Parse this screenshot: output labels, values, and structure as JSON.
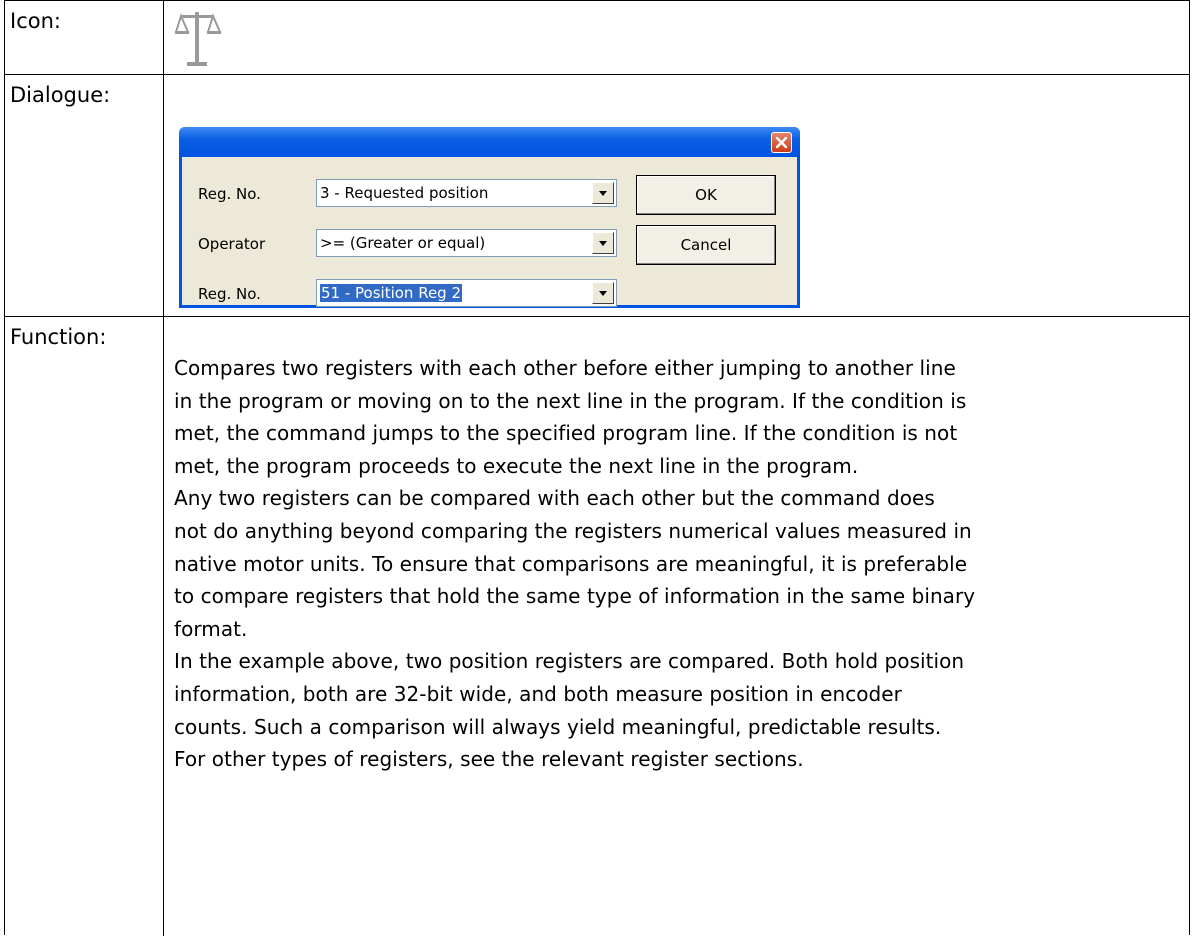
{
  "labels": {
    "icon": "Icon:",
    "dialogue": "Dialogue:",
    "function": "Function:"
  },
  "icon": {
    "name": "scales-icon"
  },
  "dialog": {
    "row1": {
      "label": "Reg. No.",
      "value": "3 - Requested position"
    },
    "row2": {
      "label": "Operator",
      "value": ">= (Greater or equal)"
    },
    "row3": {
      "label": "Reg. No.",
      "value": "51 - Position Reg 2"
    },
    "ok_label": "OK",
    "cancel_label": "Cancel",
    "colors": {
      "title": "#0054e3",
      "body": "#ece9d8",
      "selection": "#316ac5"
    }
  },
  "function_text": {
    "lines": [
      "Compares two registers with each other before either jumping to another line",
      "in the program or moving on to the next line in the program. If the condition is",
      "met, the command jumps to the specified program line. If the condition is not",
      "met, the program proceeds to execute the next line in the program.",
      "Any two registers can be compared with each other but the command does",
      "not do anything beyond comparing the registers numerical values measured in",
      "native motor units. To ensure that comparisons are meaningful, it is preferable",
      "to compare registers that hold the same type of information in the same binary",
      "format.",
      "In the example above, two position registers are compared. Both hold position",
      "information, both are 32-bit wide, and both measure position in encoder",
      "counts. Such a comparison will always yield meaningful, predictable results.",
      "For other types of registers, see the relevant register sections."
    ]
  }
}
